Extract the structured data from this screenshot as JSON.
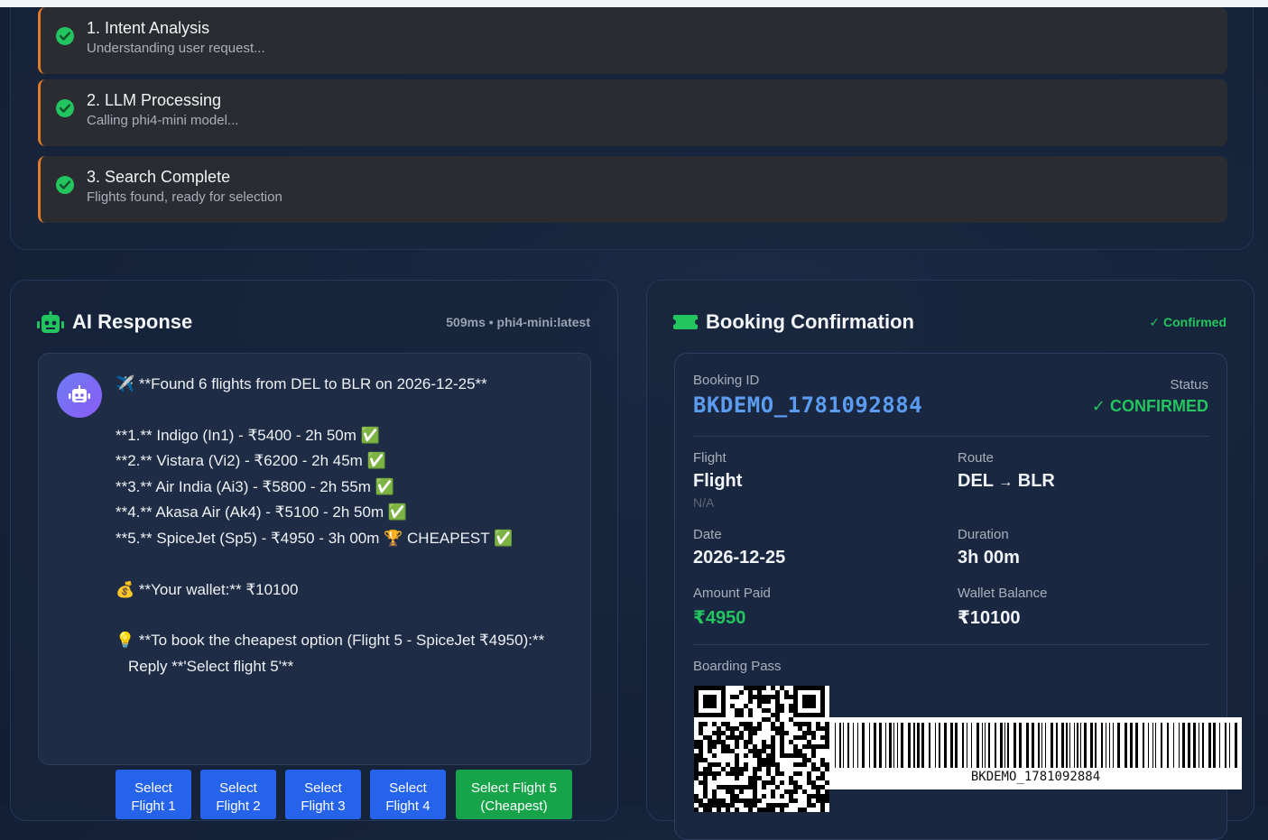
{
  "steps": [
    {
      "title": "1. Intent Analysis",
      "desc": "Understanding user request..."
    },
    {
      "title": "2. LLM Processing",
      "desc": "Calling phi4-mini model..."
    },
    {
      "title": "3. Search Complete",
      "desc": "Flights found, ready for selection"
    }
  ],
  "ai_panel": {
    "title": "AI Response",
    "meta": "509ms • phi4-mini:latest",
    "messages": {
      "header": "✈️ **Found 6 flights from DEL to BLR on 2026-12-25**",
      "flights": [
        "**1.** Indigo (In1) - ₹5400 - 2h 50m ✅",
        "**2.** Vistara (Vi2) - ₹6200 - 2h 45m ✅",
        "**3.** Air India (Ai3) - ₹5800 - 2h 55m ✅",
        "**4.** Akasa Air (Ak4) - ₹5100 - 2h 50m ✅",
        "**5.** SpiceJet (Sp5) - ₹4950 - 3h 00m 🏆 CHEAPEST ✅"
      ],
      "wallet": "💰 **Your wallet:** ₹10100",
      "tip": "💡 **To book the cheapest option (Flight 5 - SpiceJet ₹4950):**",
      "reply": "Reply **'Select flight 5'**"
    },
    "buttons": [
      {
        "line1": "Select",
        "line2": "Flight 1"
      },
      {
        "line1": "Select",
        "line2": "Flight 2"
      },
      {
        "line1": "Select",
        "line2": "Flight 3"
      },
      {
        "line1": "Select",
        "line2": "Flight 4"
      },
      {
        "line1": "Select Flight 5",
        "line2": "(Cheapest)"
      }
    ]
  },
  "booking": {
    "title": "Booking Confirmation",
    "badge": "✓ Confirmed",
    "booking_id_label": "Booking ID",
    "booking_id": "BKDEMO_1781092884",
    "status_label": "Status",
    "status": "✓ CONFIRMED",
    "flight_label": "Flight",
    "flight": "Flight",
    "flight_sub": "N/A",
    "route_label": "Route",
    "route_from": "DEL",
    "route_arrow": "→",
    "route_to": "BLR",
    "date_label": "Date",
    "date": "2026-12-25",
    "duration_label": "Duration",
    "duration": "3h 00m",
    "amount_label": "Amount Paid",
    "amount": "₹4950",
    "wallet_label": "Wallet Balance",
    "wallet": "₹10100",
    "boarding_label": "Boarding Pass",
    "barcode_text": "BKDEMO_1781092884"
  },
  "colors": {
    "accent_orange": "#e17a2b",
    "success_green": "#22c55e",
    "primary_blue": "#2563eb",
    "id_blue": "#5b9cf0"
  }
}
